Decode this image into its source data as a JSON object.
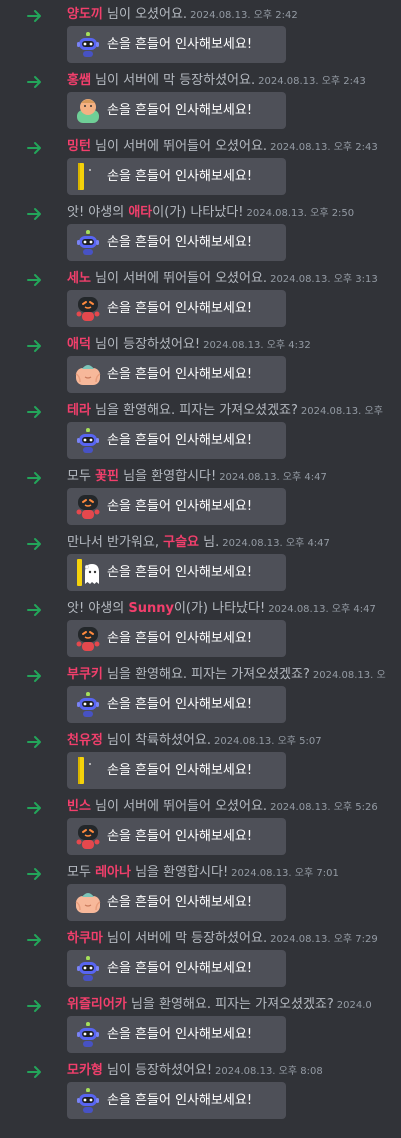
{
  "wave_label": "손을 흔들어 인사해보세요!",
  "colors": {
    "name": "#f23f6c",
    "arrow": "#23a55a",
    "button": "#4e5058",
    "background": "#313338"
  },
  "messages": [
    {
      "before": "",
      "name": "양도끼",
      "after": " 님이 오셨어요.",
      "timestamp": "2024.08.13. 오후 2:42",
      "sticker": "wumpus-robot-icon"
    },
    {
      "before": "",
      "name": "홍쌤",
      "after": " 님이 서버에 막 등장하셨어요.",
      "timestamp": "2024.08.13. 오후 2:43",
      "sticker": "green-face-icon"
    },
    {
      "before": "",
      "name": "밍턴",
      "after": " 님이 서버에 뛰어들어 오셨어요.",
      "timestamp": "2024.08.13. 오후 2:43",
      "sticker": "yellow-banner-icon"
    },
    {
      "before": "앗! 야생의 ",
      "name": "애타",
      "after": "이(가) 나타났다!",
      "timestamp": "2024.08.13. 오후 2:50",
      "sticker": "wumpus-robot-icon"
    },
    {
      "before": "",
      "name": "세노",
      "after": " 님이 서버에 뛰어들어 오셨어요.",
      "timestamp": "2024.08.13. 오후 3:13",
      "sticker": "red-robot-icon"
    },
    {
      "before": "",
      "name": "애덕",
      "after": " 님이 등장하셨어요!",
      "timestamp": "2024.08.13. 오후 4:32",
      "sticker": "peach-hand-icon"
    },
    {
      "before": "",
      "name": "테라",
      "after": " 님을 환영해요. 피자는 가져오셨겠죠?",
      "timestamp": "2024.08.13. 오후",
      "sticker": "wumpus-robot-icon"
    },
    {
      "before": "모두 ",
      "name": "꽃핀",
      "after": " 님을 환영합시다!",
      "timestamp": "2024.08.13. 오후 4:47",
      "sticker": "red-robot-icon"
    },
    {
      "before": "만나서 반가워요, ",
      "name": "구슬요",
      "after": " 님.",
      "timestamp": "2024.08.13. 오후 4:47",
      "sticker": "ghost-banner-icon"
    },
    {
      "before": "앗! 야생의 ",
      "name": "Sunny",
      "after": "이(가) 나타났다!",
      "timestamp": "2024.08.13. 오후 4:47",
      "sticker": "red-robot-icon"
    },
    {
      "before": "",
      "name": "부쿠키",
      "after": " 님을 환영해요. 피자는 가져오셨겠죠?",
      "timestamp": "2024.08.13. 오",
      "sticker": "wumpus-robot-icon"
    },
    {
      "before": "",
      "name": "천유정",
      "after": " 님이 착륙하셨어요.",
      "timestamp": "2024.08.13. 오후 5:07",
      "sticker": "yellow-banner-icon"
    },
    {
      "before": "",
      "name": "빈스",
      "after": " 님이 서버에 뛰어들어 오셨어요.",
      "timestamp": "2024.08.13. 오후 5:26",
      "sticker": "red-robot-icon"
    },
    {
      "before": "모두 ",
      "name": "레아나",
      "after": " 님을 환영합시다!",
      "timestamp": "2024.08.13. 오후 7:01",
      "sticker": "peach-hand-icon"
    },
    {
      "before": "",
      "name": "하쿠마",
      "after": " 님이 서버에 막 등장하셨어요.",
      "timestamp": "2024.08.13. 오후 7:29",
      "sticker": "wumpus-robot-icon"
    },
    {
      "before": "",
      "name": "위즐리어카",
      "after": " 님을 환영해요. 피자는 가져오셨겠죠?",
      "timestamp": "2024.0",
      "sticker": "wumpus-robot-icon"
    },
    {
      "before": "",
      "name": "모카형",
      "after": " 님이 등장하셨어요!",
      "timestamp": "2024.08.13. 오후 8:08",
      "sticker": "wumpus-robot-icon"
    }
  ]
}
